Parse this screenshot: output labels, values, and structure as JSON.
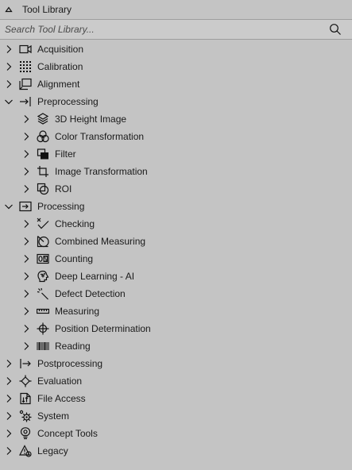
{
  "panel": {
    "title": "Tool Library",
    "search_placeholder": "Search Tool Library..."
  },
  "tree": {
    "acquisition": "Acquisition",
    "calibration": "Calibration",
    "alignment": "Alignment",
    "preprocessing": {
      "label": "Preprocessing",
      "expanded": true,
      "children": {
        "height3d": "3D Height Image",
        "color": "Color Transformation",
        "filter": "Filter",
        "imgtrans": "Image Transformation",
        "roi": "ROI"
      }
    },
    "processing": {
      "label": "Processing",
      "expanded": true,
      "children": {
        "checking": "Checking",
        "combined": "Combined Measuring",
        "counting": "Counting",
        "deep": "Deep Learning - AI",
        "defect": "Defect Detection",
        "measuring": "Measuring",
        "position": "Position Determination",
        "reading": "Reading"
      }
    },
    "postprocessing": "Postprocessing",
    "evaluation": "Evaluation",
    "fileaccess": "File Access",
    "system": "System",
    "concept": "Concept Tools",
    "legacy": "Legacy"
  },
  "icons": {
    "panel_collapse": "triangle-up-icon",
    "search": "magnifier-icon",
    "collapsed": "chevron-right-icon",
    "expanded": "chevron-down-icon"
  },
  "colors": {
    "background": "#c4c4c4",
    "search_background": "#cbcbcb",
    "text": "#1a1a1a"
  }
}
